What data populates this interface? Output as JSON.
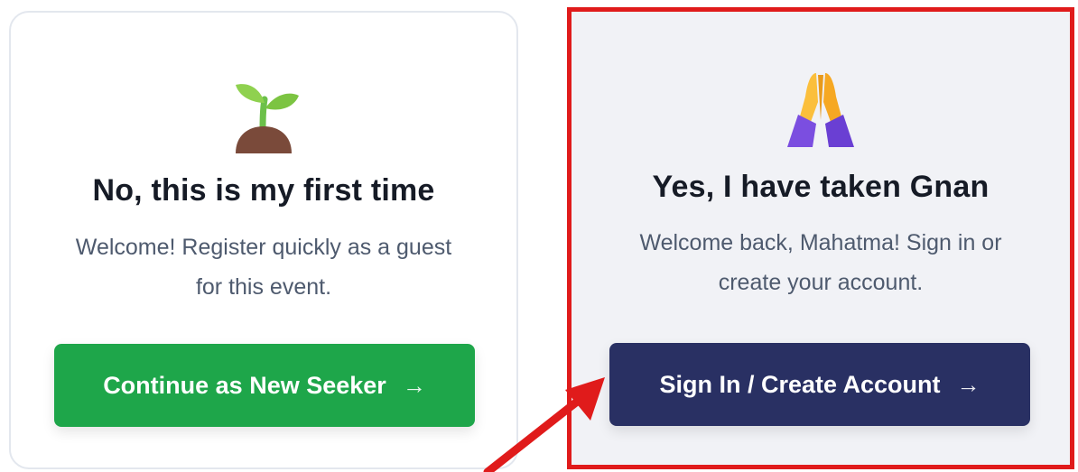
{
  "left_card": {
    "icon": "seedling-icon",
    "title": "No, this is my first time",
    "subtitle": "Welcome! Register quickly as a guest for this event.",
    "button_label": "Continue as New Seeker",
    "button_arrow": "→",
    "button_color": "#1ea64a"
  },
  "right_card": {
    "icon": "folded-hands-icon",
    "title": "Yes, I have taken Gnan",
    "subtitle": "Welcome back, Mahatma! Sign in or create your account.",
    "button_label": "Sign In / Create Account",
    "button_arrow": "→",
    "button_color": "#293063",
    "highlight_color": "#e01b1b"
  }
}
